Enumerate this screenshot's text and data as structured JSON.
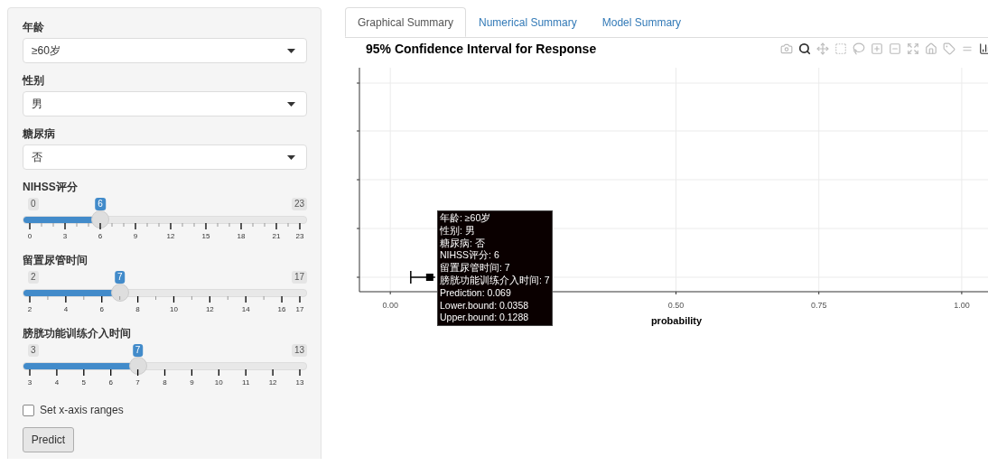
{
  "sidebar": {
    "selects": [
      {
        "label": "年龄",
        "value": "≥60岁"
      },
      {
        "label": "性别",
        "value": "男"
      },
      {
        "label": "糖尿病",
        "value": "否"
      }
    ],
    "sliders": [
      {
        "label": "NIHSS评分",
        "min": "0",
        "max": "23",
        "value": "6",
        "level": 0.2609,
        "ticks": [
          "0",
          "3",
          "6",
          "9",
          "12",
          "15",
          "18",
          "21",
          "23"
        ]
      },
      {
        "label": "留置尿管时间",
        "min": "2",
        "max": "17",
        "value": "7",
        "level": 0.3333,
        "ticks": [
          "2",
          "4",
          "6",
          "8",
          "10",
          "12",
          "14",
          "16",
          "17"
        ]
      },
      {
        "label": "膀胱功能训练介入时间",
        "min": "3",
        "max": "13",
        "value": "7",
        "level": 0.4,
        "ticks": [
          "3",
          "4",
          "5",
          "6",
          "7",
          "8",
          "9",
          "10",
          "11",
          "12",
          "13"
        ]
      }
    ],
    "checkbox": {
      "label": "Set x-axis ranges",
      "checked": false
    },
    "button": "Predict"
  },
  "tabs": [
    {
      "label": "Graphical Summary",
      "selected": true
    },
    {
      "label": "Numerical Summary",
      "selected": false
    },
    {
      "label": "Model Summary",
      "selected": false
    }
  ],
  "plot": {
    "title": "95% Confidence Interval for Response",
    "modebar": [
      {
        "kind": "camera",
        "selected": false
      },
      {
        "kind": "zoom",
        "selected": true
      },
      {
        "kind": "pan",
        "selected": false
      },
      {
        "kind": "box",
        "selected": false
      },
      {
        "kind": "lasso",
        "selected": false
      },
      {
        "kind": "zoomin",
        "selected": false
      },
      {
        "kind": "zoomout",
        "selected": false
      },
      {
        "kind": "autoscale",
        "selected": false
      },
      {
        "kind": "home",
        "selected": false
      },
      {
        "kind": "spike",
        "selected": false
      },
      {
        "kind": "compare",
        "selected": false
      },
      {
        "kind": "logo",
        "selected": false
      }
    ],
    "chart_data": {
      "type": "scatter",
      "orientation": "horizontal",
      "xlabel": "probability",
      "xlim": [
        -0.054,
        1.046
      ],
      "grid": true,
      "xticks": [
        {
          "value": 0,
          "label": "0.00"
        },
        {
          "value": 0.5,
          "label": "0.50"
        },
        {
          "value": 0.75,
          "label": "0.75"
        },
        {
          "value": 1,
          "label": "1.00"
        }
      ],
      "categories": [
        null
      ],
      "series": [
        {
          "color": "#000000",
          "values": [
            0.069
          ]
        }
      ]
    },
    "tooltip": [
      "年龄: ≥60岁",
      "性别: 男",
      "糖尿病: 否",
      "NIHSS评分: 6",
      "留置尿管时间: 7",
      "膀胱功能训练介入时间: 7",
      "Prediction: 0.069",
      "Lower.bound: 0.0358",
      "Upper.bound: 0.1288"
    ]
  }
}
